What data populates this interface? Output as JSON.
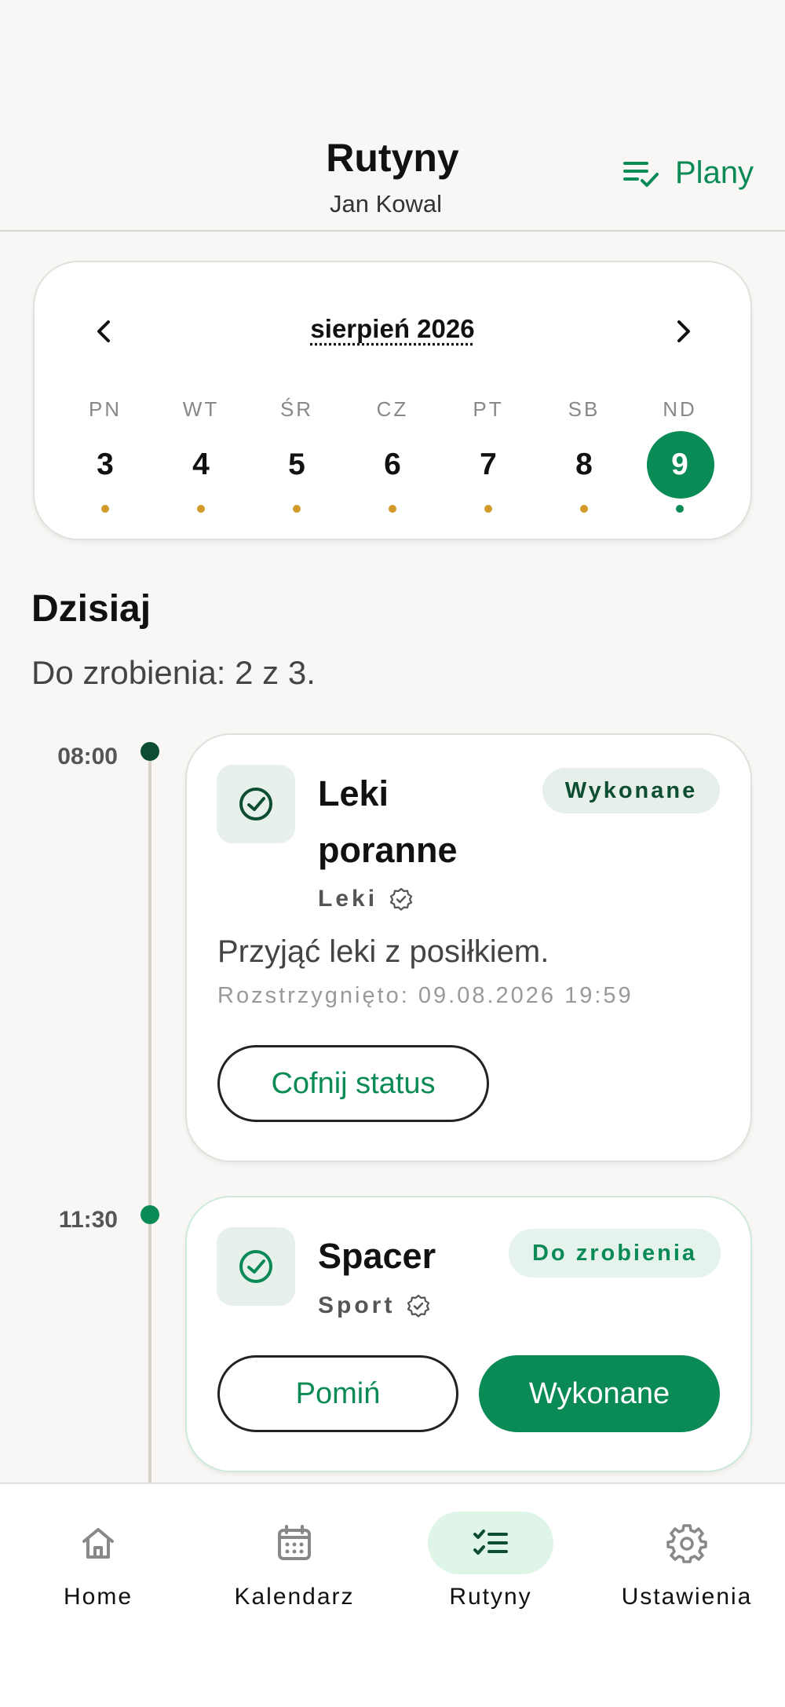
{
  "header": {
    "title": "Rutyny",
    "subtitle": "Jan Kowal",
    "plans_label": "Plany"
  },
  "calendar": {
    "month_label": "sierpień 2026",
    "days": [
      {
        "dow": "PN",
        "num": "3"
      },
      {
        "dow": "WT",
        "num": "4"
      },
      {
        "dow": "ŚR",
        "num": "5"
      },
      {
        "dow": "CZ",
        "num": "6"
      },
      {
        "dow": "PT",
        "num": "7"
      },
      {
        "dow": "SB",
        "num": "8"
      },
      {
        "dow": "ND",
        "num": "9"
      }
    ],
    "selected_day": "9"
  },
  "today": {
    "title": "Dzisiaj",
    "summary": "Do zrobienia: 2 z 3."
  },
  "routines": [
    {
      "time": "08:00",
      "title_line1": "Leki",
      "title_line2": "poranne",
      "category": "Leki",
      "status": "Wykonane",
      "description": "Przyjąć leki z posiłkiem.",
      "resolved": "Rozstrzygnięto: 09.08.2026 19:59",
      "undo_label": "Cofnij status"
    },
    {
      "time": "11:30",
      "title": "Spacer",
      "category": "Sport",
      "status": "Do zrobienia",
      "skip_label": "Pomiń",
      "done_label": "Wykonane"
    }
  ],
  "colors": {
    "accent": "#0a8a55",
    "accent_dark": "#0d4d32",
    "day_dot": "#d19a2a",
    "background": "#f8f7f5"
  },
  "nav": [
    {
      "label": "Home",
      "icon": "home-icon"
    },
    {
      "label": "Kalendarz",
      "icon": "calendar-icon"
    },
    {
      "label": "Rutyny",
      "icon": "checklist-icon",
      "active": true
    },
    {
      "label": "Ustawienia",
      "icon": "gear-icon"
    }
  ]
}
